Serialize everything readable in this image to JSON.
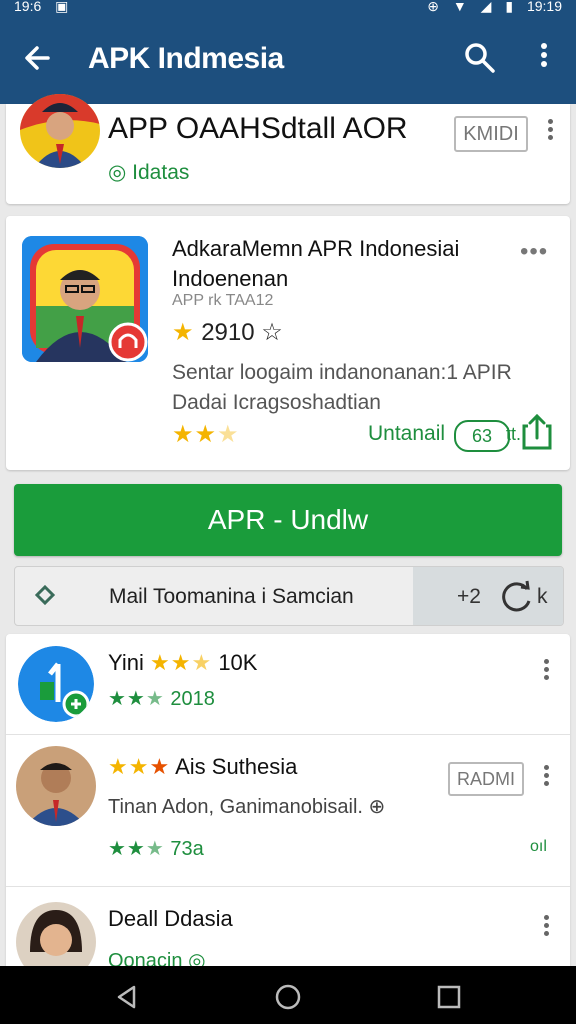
{
  "status_bar": {
    "left_time": "19:6",
    "right_time": "19:19"
  },
  "app_bar": {
    "title": "APK Indmesia"
  },
  "card1": {
    "name": "APP OAAHSdtall AOR",
    "subtitle": "Idatas",
    "button": "KMIDI"
  },
  "card2": {
    "name": "AdkaraMemn APR Indonesiai Indoenenan",
    "developer": "APP rk TAA12",
    "rating": "2910",
    "description": "Sentar loogaim indanonanan:1 APIR Dadai Icragsoshadtian",
    "install_label": "Untanail",
    "pill": "63",
    "pill_suffix": "tt."
  },
  "main_button": {
    "label": "APR - Undlw"
  },
  "strip": {
    "label": "Mail Toomanina i Samcian",
    "count": "+2",
    "k": "k"
  },
  "list": [
    {
      "title": "Yini",
      "title_suffix": "10K",
      "stars_text": "2018"
    },
    {
      "title": "Ais  Suthesia",
      "subtitle": "Tinan Adon, Ganimanobisail.",
      "stars_text": "73a",
      "button": "RADMI",
      "side": "oıl"
    },
    {
      "title": "Deall Ddasia",
      "subtitle": "Oonacin"
    }
  ],
  "colors": {
    "app_bar": "#1d4f7e",
    "green": "#1a9c3b",
    "star": "#f4b400"
  }
}
